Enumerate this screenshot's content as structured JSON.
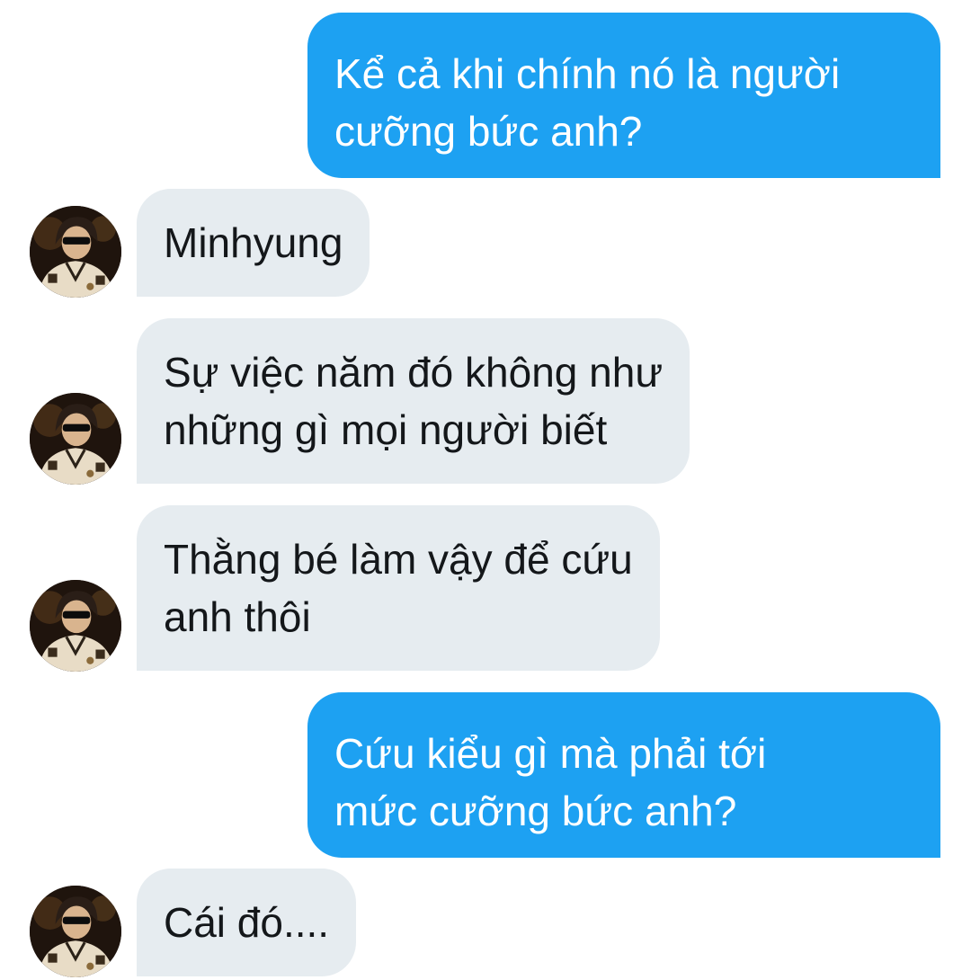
{
  "conversation": {
    "contact_name": "Minhyung",
    "messages": [
      {
        "sender": "me",
        "text": "Kể cả khi chính nó là người\ncưỡng bức anh?"
      },
      {
        "sender": "contact",
        "text": "Minhyung"
      },
      {
        "sender": "contact",
        "text": "Sự việc năm đó không như\nnhững gì mọi người biết"
      },
      {
        "sender": "contact",
        "text": "Thằng bé làm vậy để cứu\nanh thôi"
      },
      {
        "sender": "me",
        "text": "Cứu kiểu gì mà phải tới\nmức cưỡng bức anh?"
      },
      {
        "sender": "contact",
        "text": "Cái đó...."
      }
    ]
  },
  "colors": {
    "sent_bubble": "#1da1f2",
    "sent_text": "#ffffff",
    "received_bubble": "#e6ecf0",
    "received_text": "#14171a"
  },
  "icons": {
    "avatar": "contact-avatar-photo"
  }
}
